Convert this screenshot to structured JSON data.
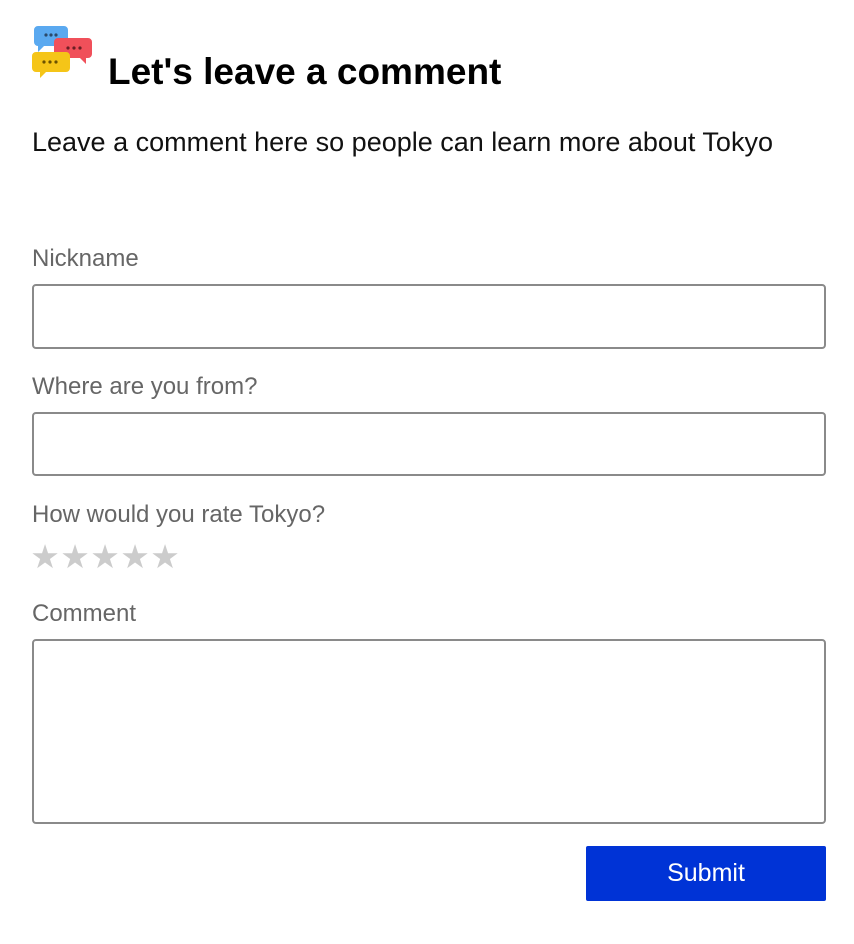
{
  "header": {
    "title": "Let's leave a comment",
    "logo_icon": "chat-bubbles-icon",
    "logo_colors": [
      "#5aa9f0",
      "#f0505a",
      "#f5c518"
    ]
  },
  "intro": "Leave a comment here so people can learn more about Tokyo",
  "form": {
    "nickname": {
      "label": "Nickname",
      "value": "",
      "placeholder": ""
    },
    "origin": {
      "label": "Where are you from?",
      "value": "",
      "placeholder": ""
    },
    "rating": {
      "label": "How would you rate Tokyo?",
      "value": 0,
      "max": 5,
      "star_glyph": "★",
      "empty_color": "#cccccc"
    },
    "comment": {
      "label": "Comment",
      "value": "",
      "placeholder": ""
    },
    "submit_label": "Submit"
  },
  "colors": {
    "accent": "#0033d6",
    "label": "#666666",
    "border": "#8a8a8a"
  }
}
